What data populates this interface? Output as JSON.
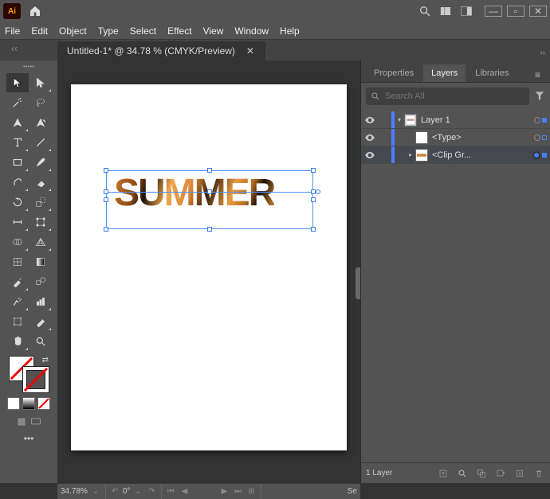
{
  "app": {
    "logo": "Ai"
  },
  "menu": [
    "File",
    "Edit",
    "Object",
    "Type",
    "Select",
    "Effect",
    "View",
    "Window",
    "Help"
  ],
  "doc_tab": {
    "title": "Untitled-1* @ 34.78 % (CMYK/Preview)"
  },
  "canvas": {
    "text": "SUMMER"
  },
  "panels": {
    "tabs": [
      "Properties",
      "Layers",
      "Libraries"
    ],
    "active_index": 1,
    "search_placeholder": "Search All",
    "layers": [
      {
        "name": "Layer 1",
        "expanded": true,
        "depth": 0,
        "visible": true,
        "thumb": "page",
        "selected": false
      },
      {
        "name": "<Type>",
        "expanded": null,
        "depth": 1,
        "visible": true,
        "thumb": "blank",
        "selected": false
      },
      {
        "name": "<Clip Gr...",
        "expanded": false,
        "depth": 1,
        "visible": true,
        "thumb": "clip",
        "selected": true
      }
    ],
    "footer": {
      "count": "1 Layer"
    }
  },
  "status": {
    "zoom": "34.78%",
    "rotate": "0°",
    "extra": ""
  }
}
